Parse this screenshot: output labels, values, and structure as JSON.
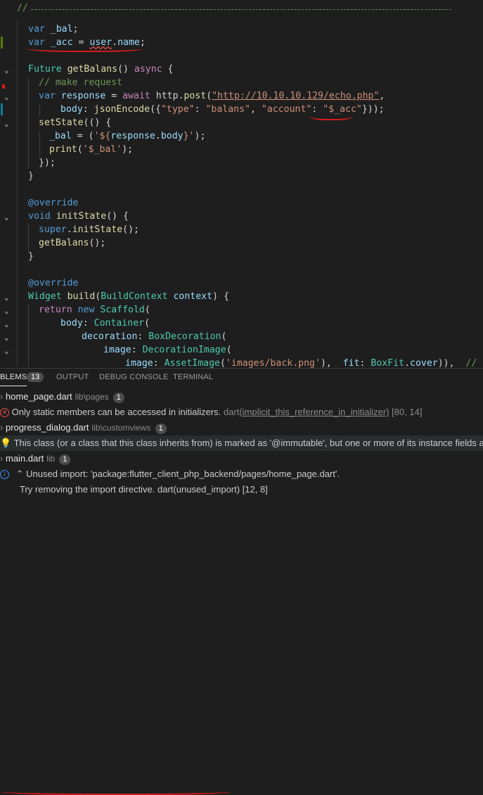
{
  "editor": {
    "separator_comment": "//",
    "lines": {
      "l1": {
        "kw": "var",
        "id": "_bal",
        "rest": ";"
      },
      "l2": {
        "kw": "var",
        "id": "_acc",
        "eq": " = ",
        "obj": "user",
        "dot": ".",
        "prop": "name",
        "rest": ";"
      },
      "l4": {
        "ty": "Future",
        "fn": "getBalans",
        "p": "() ",
        "kw": "async",
        "b": " {"
      },
      "l5": {
        "cm": "// make request"
      },
      "l6": {
        "kw": "var",
        "id": "response",
        "eq": " = ",
        "kw2": "await",
        "obj": " http.",
        "fn": "post",
        "p": "(",
        "url": "\"http://10.10.10.129/echo.php\"",
        "c": ","
      },
      "l7": {
        "id": "body",
        "c": ": ",
        "fn": "jsonEncode",
        "p": "({",
        "s1": "\"type\"",
        "c2": ": ",
        "s2": "\"balans\"",
        "c3": ", ",
        "s3": "\"account\"",
        "c4": ": ",
        "s4": "\"$_acc\"",
        "end": "}));"
      },
      "l8": {
        "fn": "setState",
        "p": "(() {"
      },
      "l9": {
        "id": "_bal",
        "eq": " = (",
        "s": "'${",
        "id2": "response",
        "dot": ".",
        "prop": "body",
        "s2": "}'",
        "end": ");"
      },
      "l10": {
        "fn": "print",
        "p": "(",
        "s": "'$_bal'",
        "end": ");"
      },
      "l11": {
        "p": "});"
      },
      "l12": {
        "p": "}"
      },
      "l14": {
        "ann": "@override"
      },
      "l15": {
        "kw": "void",
        "fn": "initState",
        "p": "() {"
      },
      "l16": {
        "kw": "super",
        "dot": ".",
        "fn": "initState",
        "p": "();"
      },
      "l17": {
        "fn": "getBalans",
        "p": "();"
      },
      "l18": {
        "p": "}"
      },
      "l20": {
        "ann": "@override"
      },
      "l21": {
        "ty": "Widget",
        "fn": "build",
        "p": "(",
        "ty2": "BuildContext",
        "id": " context",
        "p2": ") {"
      },
      "l22": {
        "kw2": "return",
        "kw": " new ",
        "ty": "Scaffold",
        "p": "("
      },
      "l23": {
        "id": "body",
        "c": ": ",
        "ty": "Container",
        "p": "("
      },
      "l24": {
        "id": "decoration",
        "c": ": ",
        "ty": "BoxDecoration",
        "p": "("
      },
      "l25": {
        "id": "image",
        "c": ": ",
        "ty": "DecorationImage",
        "p": "("
      },
      "l26": {
        "id": "image",
        "c": ": ",
        "ty": "AssetImage",
        "p": "(",
        "s": "'images/back.png'",
        "c2": "),  ",
        "id2": "fit",
        "c3": ": ",
        "ty2": "BoxFit",
        "dot": ".",
        "id3": "cover",
        "p2": ")),  ",
        "cm": "// Deco"
      }
    }
  },
  "panel": {
    "tabs": {
      "problems": "BLEMS",
      "problems_count": "13",
      "output": "OUTPUT",
      "debug": "DEBUG CONSOLE",
      "terminal": "TERMINAL"
    },
    "rows": {
      "home_page": {
        "name": "home_page.dart",
        "dir": "lib\\pages",
        "count": "1"
      },
      "err1": {
        "msg": "Only static members can be accessed in initializers.",
        "source": "dart",
        "code": "(implicit_this_reference_in_initializer)",
        "pos": "[80, 14]"
      },
      "progress": {
        "name": "progress_dialog.dart",
        "dir": "lib\\customviews",
        "count": "1"
      },
      "immutable": {
        "msg": "This class (or a class that this class inherits from) is marked as '@immutable', but one or more of its instance fields are"
      },
      "main": {
        "name": "main.dart",
        "dir": "lib",
        "count": "1"
      },
      "unused": {
        "msg": "Unused import: 'package:flutter_client_php_backend/pages/home_page.dart'."
      },
      "last": {
        "msg": "Try removing the import directive.  dart(unused_import) [12, 8]"
      }
    }
  },
  "colors": {
    "error": "#f14c4c",
    "info": "#3794ff",
    "warning": "#ffcc00",
    "annotation": "#d81b1b"
  }
}
